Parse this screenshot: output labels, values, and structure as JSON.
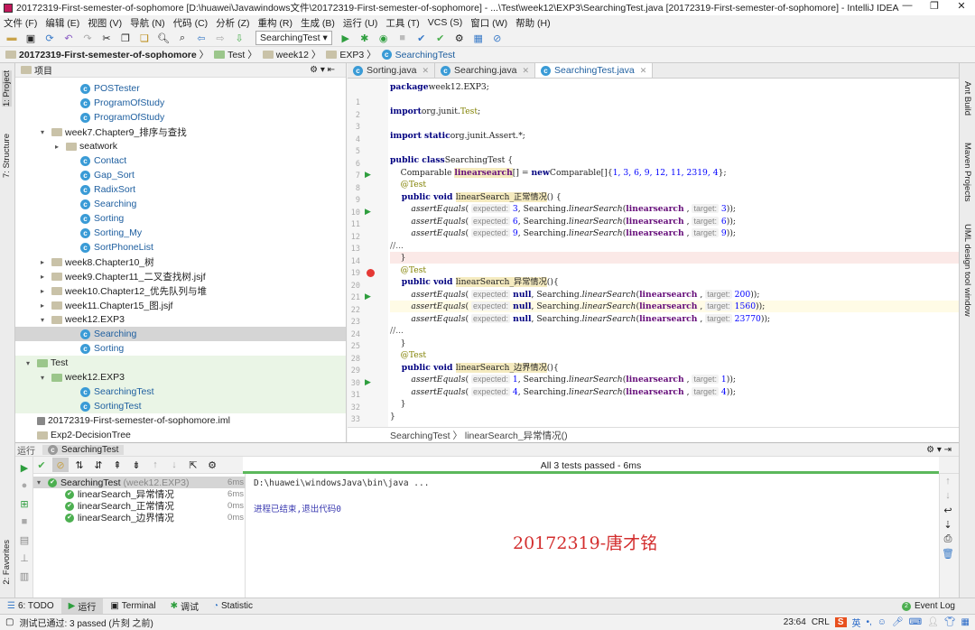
{
  "window": {
    "title": "20172319-First-semester-of-sophomore [D:\\huawei\\Javawindows文件\\20172319-First-semester-of-sophomore] - ...\\Test\\week12\\EXP3\\SearchingTest.java [20172319-First-semester-of-sophomore] - IntelliJ IDEA",
    "controls": [
      "—",
      "❐",
      "✕"
    ]
  },
  "menu": [
    "文件 (F)",
    "编辑 (E)",
    "视图 (V)",
    "导航 (N)",
    "代码 (C)",
    "分析 (Z)",
    "重构 (R)",
    "生成 (B)",
    "运行 (U)",
    "工具 (T)",
    "VCS (S)",
    "窗口 (W)",
    "帮助 (H)"
  ],
  "toolbar": {
    "run_config": "SearchingTest ▾"
  },
  "breadcrumb": [
    "20172319-First-semester-of-sophomore",
    "Test",
    "week12",
    "EXP3",
    "SearchingTest"
  ],
  "left_strip": {
    "project": "1: Project",
    "structure": "7: Structure",
    "favorites": "2: Favorites"
  },
  "project": {
    "header": "项目",
    "items": [
      {
        "level": 4,
        "icon": "class",
        "text": "POSTester"
      },
      {
        "level": 4,
        "icon": "class",
        "text": "ProgramOfStudy"
      },
      {
        "level": 4,
        "icon": "class",
        "text": "ProgramOfStudy"
      },
      {
        "level": 2,
        "icon": "folder",
        "arrow": "▾",
        "text": "week7.Chapter9_排序与查找"
      },
      {
        "level": 3,
        "icon": "folder",
        "arrow": "▸",
        "text": "seatwork"
      },
      {
        "level": 4,
        "icon": "class",
        "text": "Contact"
      },
      {
        "level": 4,
        "icon": "class",
        "text": "Gap_Sort"
      },
      {
        "level": 4,
        "icon": "class",
        "text": "RadixSort"
      },
      {
        "level": 4,
        "icon": "class",
        "text": "Searching"
      },
      {
        "level": 4,
        "icon": "class",
        "text": "Sorting"
      },
      {
        "level": 4,
        "icon": "class",
        "text": "Sorting_My"
      },
      {
        "level": 4,
        "icon": "class",
        "text": "SortPhoneList"
      },
      {
        "level": 2,
        "icon": "folder",
        "arrow": "▸",
        "text": "week8.Chapter10_树"
      },
      {
        "level": 2,
        "icon": "folder",
        "arrow": "▸",
        "text": "week9.Chapter11_二叉查找树.jsjf"
      },
      {
        "level": 2,
        "icon": "folder",
        "arrow": "▸",
        "text": "week10.Chapter12_优先队列与堆"
      },
      {
        "level": 2,
        "icon": "folder",
        "arrow": "▸",
        "text": "week11.Chapter15_图.jsjf"
      },
      {
        "level": 2,
        "icon": "folder",
        "arrow": "▾",
        "text": "week12.EXP3"
      },
      {
        "level": 4,
        "icon": "class",
        "text": "Searching",
        "state": "sel"
      },
      {
        "level": 4,
        "icon": "class",
        "text": "Sorting"
      },
      {
        "level": 1,
        "icon": "testfolder",
        "arrow": "▾",
        "text": "Test",
        "state": "test"
      },
      {
        "level": 2,
        "icon": "testfolder",
        "arrow": "▾",
        "text": "week12.EXP3",
        "state": "test"
      },
      {
        "level": 4,
        "icon": "class",
        "text": "SearchingTest",
        "state": "test"
      },
      {
        "level": 4,
        "icon": "class",
        "text": "SortingTest",
        "state": "test"
      },
      {
        "level": 1,
        "icon": "file",
        "text": "20172319-First-semester-of-sophomore.iml"
      },
      {
        "level": 1,
        "icon": "folder",
        "text": "Exp2-DecisionTree"
      }
    ]
  },
  "editor": {
    "tabs": [
      {
        "label": "Sorting.java"
      },
      {
        "label": "Searching.java"
      },
      {
        "label": "SearchingTest.java",
        "active": true
      }
    ],
    "lines": [
      {
        "n": "1",
        "t": [
          [
            "kw",
            "package"
          ],
          [
            "",
            "week12.EXP3;"
          ]
        ]
      },
      {
        "n": "2",
        "t": []
      },
      {
        "n": "3",
        "t": [
          [
            "kw",
            "import"
          ],
          [
            "",
            "org.junit."
          ],
          [
            "ann",
            "Test"
          ],
          [
            "",
            ";"
          ]
        ]
      },
      {
        "n": "4",
        "t": []
      },
      {
        "n": "5",
        "t": [
          [
            "kw",
            "import static"
          ],
          [
            "",
            "org.junit.Assert.*;"
          ]
        ]
      },
      {
        "n": "6",
        "t": []
      },
      {
        "n": "7",
        "run": true,
        "t": [
          [
            "kw",
            "public class"
          ],
          [
            "",
            "SearchingTest {"
          ]
        ]
      },
      {
        "n": "8",
        "t": [
          [
            "",
            "    Comparable "
          ],
          [
            "fld hl",
            "linearsearch"
          ],
          [
            "",
            "[] = "
          ],
          [
            "kw",
            "new"
          ],
          [
            "",
            "Comparable[]{"
          ],
          [
            "num",
            "1, 3, 6, 9, 12, 11, 2319, 4"
          ],
          [
            "",
            "};"
          ]
        ]
      },
      {
        "n": "9",
        "t": [
          [
            "ann",
            "    @Test"
          ]
        ]
      },
      {
        "n": "10",
        "run": true,
        "t": [
          [
            "kw",
            "    public void "
          ],
          [
            "hl",
            "linearSearch_正常情况"
          ],
          [
            "",
            "() {"
          ]
        ]
      },
      {
        "n": "11",
        "t": [
          [
            "it",
            "        assertEquals"
          ],
          [
            "",
            "( "
          ],
          [
            "hint",
            "expected:"
          ],
          [
            "num",
            " 3"
          ],
          [
            "",
            ", Searching."
          ],
          [
            "it",
            "linearSearch"
          ],
          [
            "",
            "("
          ],
          [
            "fld",
            "linearsearch"
          ],
          [
            "",
            " , "
          ],
          [
            "hint",
            "target:"
          ],
          [
            "num",
            " 3"
          ],
          [
            "",
            "));"
          ]
        ]
      },
      {
        "n": "12",
        "t": [
          [
            "it",
            "        assertEquals"
          ],
          [
            "",
            "( "
          ],
          [
            "hint",
            "expected:"
          ],
          [
            "num",
            " 6"
          ],
          [
            "",
            ", Searching."
          ],
          [
            "it",
            "linearSearch"
          ],
          [
            "",
            "("
          ],
          [
            "fld",
            "linearsearch"
          ],
          [
            "",
            " , "
          ],
          [
            "hint",
            "target:"
          ],
          [
            "num",
            " 6"
          ],
          [
            "",
            "));"
          ]
        ]
      },
      {
        "n": "13",
        "t": [
          [
            "it",
            "        assertEquals"
          ],
          [
            "",
            "( "
          ],
          [
            "hint",
            "expected:"
          ],
          [
            "num",
            " 9"
          ],
          [
            "",
            ", Searching."
          ],
          [
            "it",
            "linearSearch"
          ],
          [
            "",
            "("
          ],
          [
            "fld",
            "linearsearch"
          ],
          [
            "",
            " , "
          ],
          [
            "hint",
            "target:"
          ],
          [
            "num",
            " 9"
          ],
          [
            "",
            "));"
          ]
        ]
      },
      {
        "n": "14",
        "t": [
          [
            "fold",
            "//..."
          ]
        ]
      },
      {
        "n": "19",
        "bp": true,
        "t": [
          [
            "",
            "    }"
          ]
        ]
      },
      {
        "n": "20",
        "t": [
          [
            "ann",
            "    @Test"
          ]
        ]
      },
      {
        "n": "21",
        "run": true,
        "t": [
          [
            "kw",
            "    public void "
          ],
          [
            "hl",
            "linearSearch_异常情况"
          ],
          [
            "",
            "(){"
          ]
        ]
      },
      {
        "n": "22",
        "t": [
          [
            "it",
            "        assertEquals"
          ],
          [
            "",
            "( "
          ],
          [
            "hint",
            "expected:"
          ],
          [
            "kw",
            " null"
          ],
          [
            "",
            ", Searching."
          ],
          [
            "it",
            "linearSearch"
          ],
          [
            "",
            "("
          ],
          [
            "fld",
            "linearsearch"
          ],
          [
            "",
            " , "
          ],
          [
            "hint",
            "target:"
          ],
          [
            "num",
            " 200"
          ],
          [
            "",
            "));"
          ]
        ]
      },
      {
        "n": "23",
        "cur": true,
        "t": [
          [
            "it",
            "        assertEquals"
          ],
          [
            "",
            "( "
          ],
          [
            "hint",
            "expected:"
          ],
          [
            "kw",
            " null"
          ],
          [
            "",
            ", Searching."
          ],
          [
            "it",
            "linearSearch"
          ],
          [
            "",
            "("
          ],
          [
            "fld",
            "linearsearch"
          ],
          [
            "",
            " , "
          ],
          [
            "hint",
            "target:"
          ],
          [
            "num",
            " 1560"
          ],
          [
            "",
            "));"
          ]
        ]
      },
      {
        "n": "24",
        "t": [
          [
            "it",
            "        assertEquals"
          ],
          [
            "",
            "( "
          ],
          [
            "hint",
            "expected:"
          ],
          [
            "kw",
            " null"
          ],
          [
            "",
            ", Searching."
          ],
          [
            "it",
            "linearSearch"
          ],
          [
            "",
            "("
          ],
          [
            "fld",
            "linearsearch"
          ],
          [
            "",
            " , "
          ],
          [
            "hint",
            "target:"
          ],
          [
            "num",
            " 23770"
          ],
          [
            "",
            "));"
          ]
        ]
      },
      {
        "n": "25",
        "t": [
          [
            "fold",
            "//..."
          ]
        ]
      },
      {
        "n": "28",
        "t": [
          [
            "",
            "    }"
          ]
        ]
      },
      {
        "n": "29",
        "t": [
          [
            "ann",
            "    @Test"
          ]
        ]
      },
      {
        "n": "30",
        "run": true,
        "t": [
          [
            "kw",
            "    public void "
          ],
          [
            "hl",
            "linearSearch_边界情况"
          ],
          [
            "",
            "(){"
          ]
        ]
      },
      {
        "n": "31",
        "t": [
          [
            "it",
            "        assertEquals"
          ],
          [
            "",
            "( "
          ],
          [
            "hint",
            "expected:"
          ],
          [
            "num",
            " 1"
          ],
          [
            "",
            ", Searching."
          ],
          [
            "it",
            "linearSearch"
          ],
          [
            "",
            "("
          ],
          [
            "fld",
            "linearsearch"
          ],
          [
            "",
            " , "
          ],
          [
            "hint",
            "target:"
          ],
          [
            "num",
            " 1"
          ],
          [
            "",
            "));"
          ]
        ]
      },
      {
        "n": "32",
        "t": [
          [
            "it",
            "        assertEquals"
          ],
          [
            "",
            "( "
          ],
          [
            "hint",
            "expected:"
          ],
          [
            "num",
            " 4"
          ],
          [
            "",
            ", Searching."
          ],
          [
            "it",
            "linearSearch"
          ],
          [
            "",
            "("
          ],
          [
            "fld",
            "linearsearch"
          ],
          [
            "",
            " , "
          ],
          [
            "hint",
            "target:"
          ],
          [
            "num",
            " 4"
          ],
          [
            "",
            "));"
          ]
        ]
      },
      {
        "n": "33",
        "t": [
          [
            "",
            "    }"
          ]
        ]
      },
      {
        "n": "34",
        "t": [
          [
            "",
            "}"
          ]
        ]
      }
    ],
    "crumbs": "SearchingTest  〉 linearSearch_异常情况()"
  },
  "right_strip": [
    "Ant Build",
    "Maven Projects",
    "UML design tool window"
  ],
  "run": {
    "label": "运行",
    "config": "SearchingTest",
    "status": "All 3 tests passed - 6ms",
    "tests": [
      {
        "name": "SearchingTest",
        "pkg": "(week12.EXP3)",
        "time": "6ms",
        "level": 0
      },
      {
        "name": "linearSearch_异常情况",
        "time": "6ms",
        "level": 1
      },
      {
        "name": "linearSearch_正常情况",
        "time": "0ms",
        "level": 1
      },
      {
        "name": "linearSearch_边界情况",
        "time": "0ms",
        "level": 1
      }
    ],
    "console": [
      "D:\\huawei\\windowsJava\\bin\\java ...",
      "",
      "进程已结束,退出代码0"
    ],
    "watermark": "20172319-唐才铭"
  },
  "bottom_tabs": [
    {
      "label": "6: TODO"
    },
    {
      "label": "运行",
      "active": true
    },
    {
      "label": "Terminal"
    },
    {
      "label": "调试"
    },
    {
      "label": "Statistic"
    }
  ],
  "event_log": {
    "count": "2",
    "label": "Event Log"
  },
  "status": {
    "message": "测试已通过: 3 passed (片刻 之前)",
    "position": "23:64",
    "line_sep": "CRL",
    "ime": "英"
  },
  "colors": {
    "accent": "#3a9bd6",
    "pass": "#4caf50",
    "watermark": "#d32f2f"
  }
}
